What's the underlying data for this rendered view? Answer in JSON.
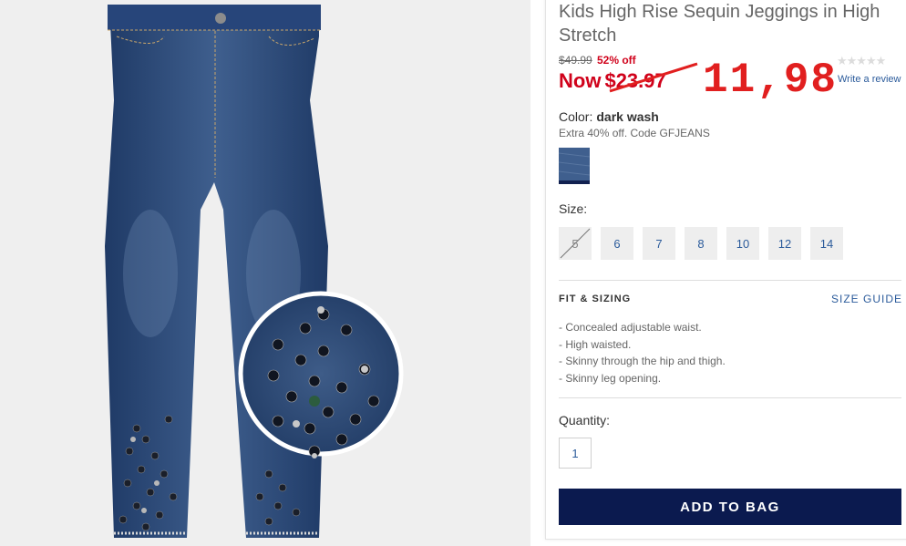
{
  "product": {
    "title": "Kids High Rise Sequin Jeggings in High Stretch",
    "image_icon": "jeans-product-image"
  },
  "pricing": {
    "original_price": "$49.99",
    "discount": "52% off",
    "now_label": "Now",
    "now_price": "$23.97",
    "handwritten_price": "11,98",
    "sale_color": "#d0021b",
    "handwritten_color": "#e11f1f"
  },
  "rating": {
    "stars": "★★★★★",
    "value": 0,
    "write_review": "Write a review"
  },
  "color": {
    "label": "Color:",
    "value": "dark wash",
    "promo": "Extra 40% off. Code GFJEANS",
    "swatch_color": "#3f5f8e"
  },
  "size": {
    "label": "Size:",
    "options": [
      {
        "label": "5",
        "available": false
      },
      {
        "label": "6",
        "available": true
      },
      {
        "label": "7",
        "available": true
      },
      {
        "label": "8",
        "available": true
      },
      {
        "label": "10",
        "available": true
      },
      {
        "label": "12",
        "available": true
      },
      {
        "label": "14",
        "available": true
      }
    ]
  },
  "fit": {
    "heading": "FIT & SIZING",
    "size_guide": "SIZE GUIDE",
    "features": [
      "- Concealed adjustable waist.",
      "- High waisted.",
      "- Skinny through the hip and thigh.",
      "- Skinny leg opening."
    ]
  },
  "quantity": {
    "label": "Quantity:",
    "value": "1"
  },
  "cart": {
    "add_to_bag": "ADD TO BAG",
    "button_color": "#0b1a4f"
  },
  "accent_link_color": "#2b5b9b"
}
